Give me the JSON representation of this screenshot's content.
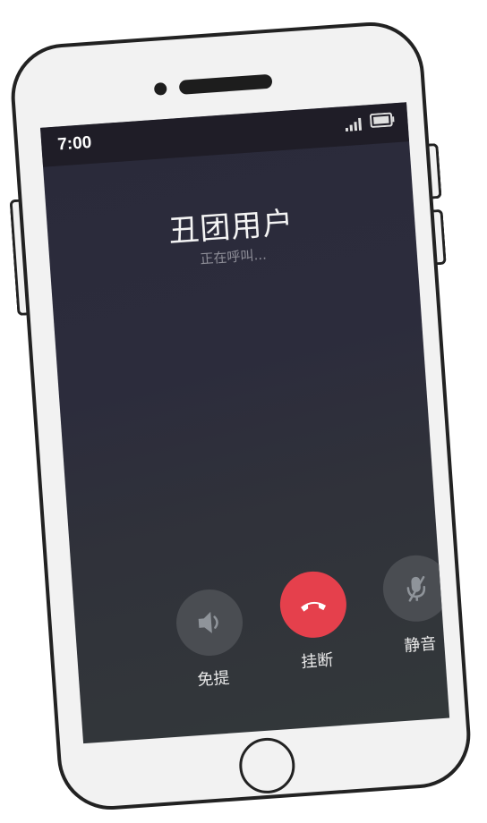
{
  "status_bar": {
    "time": "7:00",
    "signal_icon": "signal-bars-icon",
    "battery_icon": "battery-icon"
  },
  "call": {
    "caller_name": "丑团用户",
    "status": "正在呼叫..."
  },
  "controls": {
    "speaker": {
      "label": "免提",
      "icon": "speaker-icon"
    },
    "hangup": {
      "label": "挂断",
      "icon": "phone-hangup-icon"
    },
    "mute": {
      "label": "静音",
      "icon": "mic-off-icon"
    }
  },
  "colors": {
    "hangup": "#e5404c",
    "control_bg": "#4a4d52",
    "screen_top": "#2a2a3a",
    "screen_bottom": "#33383a",
    "status_bar": "#1f1d27"
  }
}
